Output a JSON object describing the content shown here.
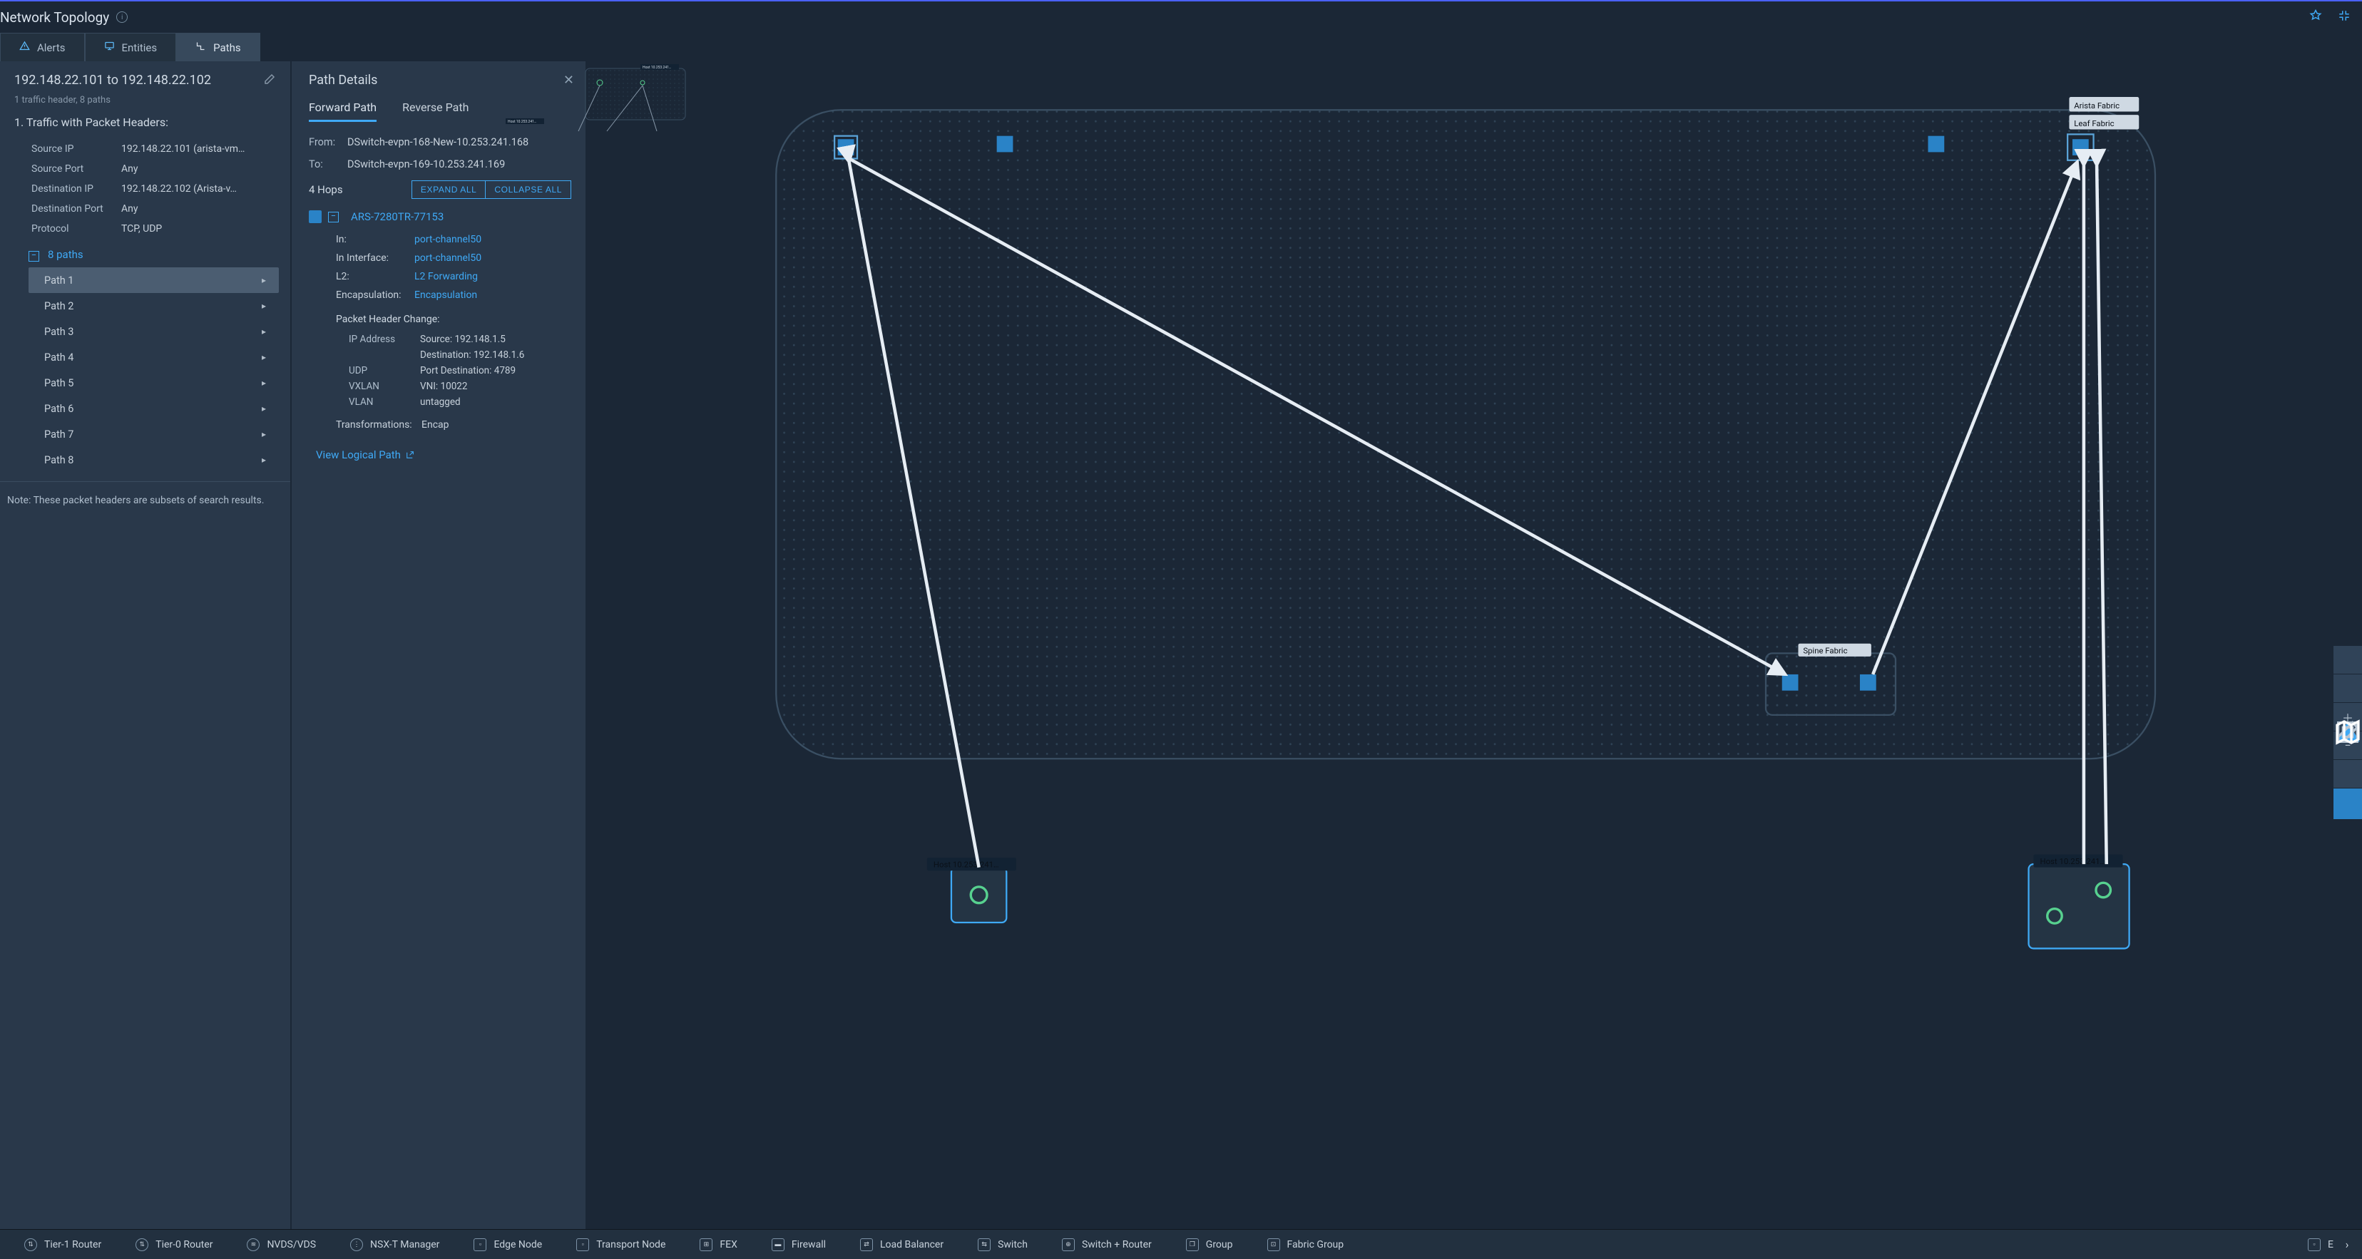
{
  "header": {
    "title": "Network Topology"
  },
  "tabs": {
    "alerts": "Alerts",
    "entities": "Entities",
    "paths": "Paths"
  },
  "left": {
    "title": "192.148.22.101 to 192.148.22.102",
    "sub": "1 traffic header, 8 paths",
    "traffic_h": "1. Traffic with Packet Headers:",
    "kv": {
      "src_ip_k": "Source IP",
      "src_ip_v": "192.148.22.101 (arista-vm…",
      "src_port_k": "Source Port",
      "src_port_v": "Any",
      "dst_ip_k": "Destination IP",
      "dst_ip_v": "192.148.22.102 (Arista-v…",
      "dst_port_k": "Destination Port",
      "dst_port_v": "Any",
      "proto_k": "Protocol",
      "proto_v": "TCP, UDP"
    },
    "paths_label": "8 paths",
    "paths": [
      "Path 1",
      "Path 2",
      "Path 3",
      "Path 4",
      "Path 5",
      "Path 6",
      "Path 7",
      "Path 8"
    ],
    "note": "Note: These packet headers are subsets of search results."
  },
  "detail": {
    "title": "Path Details",
    "tab_fwd": "Forward Path",
    "tab_rev": "Reverse Path",
    "from_k": "From:",
    "from_v": "DSwitch-evpn-168-New-10.253.241.168",
    "to_k": "To:",
    "to_v": "DSwitch-evpn-169-10.253.241.169",
    "hops": "4 Hops",
    "expand": "EXPAND ALL",
    "collapse": "COLLAPSE ALL",
    "hop1": {
      "name": "ARS-7280TR-77153",
      "in_k": "In:",
      "in_v": "port-channel50",
      "inif_k": "In Interface:",
      "inif_v": "port-channel50",
      "l2_k": "L2:",
      "l2_v": "L2 Forwarding",
      "enc_k": "Encapsulation:",
      "enc_v": "Encapsulation",
      "phc": "Packet Header Change:",
      "ipa_k": "IP Address",
      "ipa_v1": "Source: 192.148.1.5",
      "ipa_v2": "Destination: 192.148.1.6",
      "udp_k": "UDP",
      "udp_v": "Port Destination: 4789",
      "vx_k": "VXLAN",
      "vx_v": "VNI: 10022",
      "vl_k": "VLAN",
      "vl_v": "untagged",
      "tr_k": "Transformations:",
      "tr_v": "Encap"
    },
    "view_logical": "View Logical Path"
  },
  "topology": {
    "zones": {
      "arista": "Arista Fabric",
      "leaf": "Leaf Fabric",
      "spine": "Spine Fabric"
    },
    "hosts": {
      "h168": "Host 10.253.241…",
      "h169": "Host 10.253.241…",
      "h_mini": "Host 10.253.241…"
    }
  },
  "legend": {
    "items": [
      "Tier-1 Router",
      "Tier-0 Router",
      "NVDS/VDS",
      "NSX-T Manager",
      "Edge Node",
      "Transport Node",
      "FEX",
      "Firewall",
      "Load Balancer",
      "Switch",
      "Switch + Router",
      "Group",
      "Fabric Group"
    ],
    "overflow": "E"
  }
}
